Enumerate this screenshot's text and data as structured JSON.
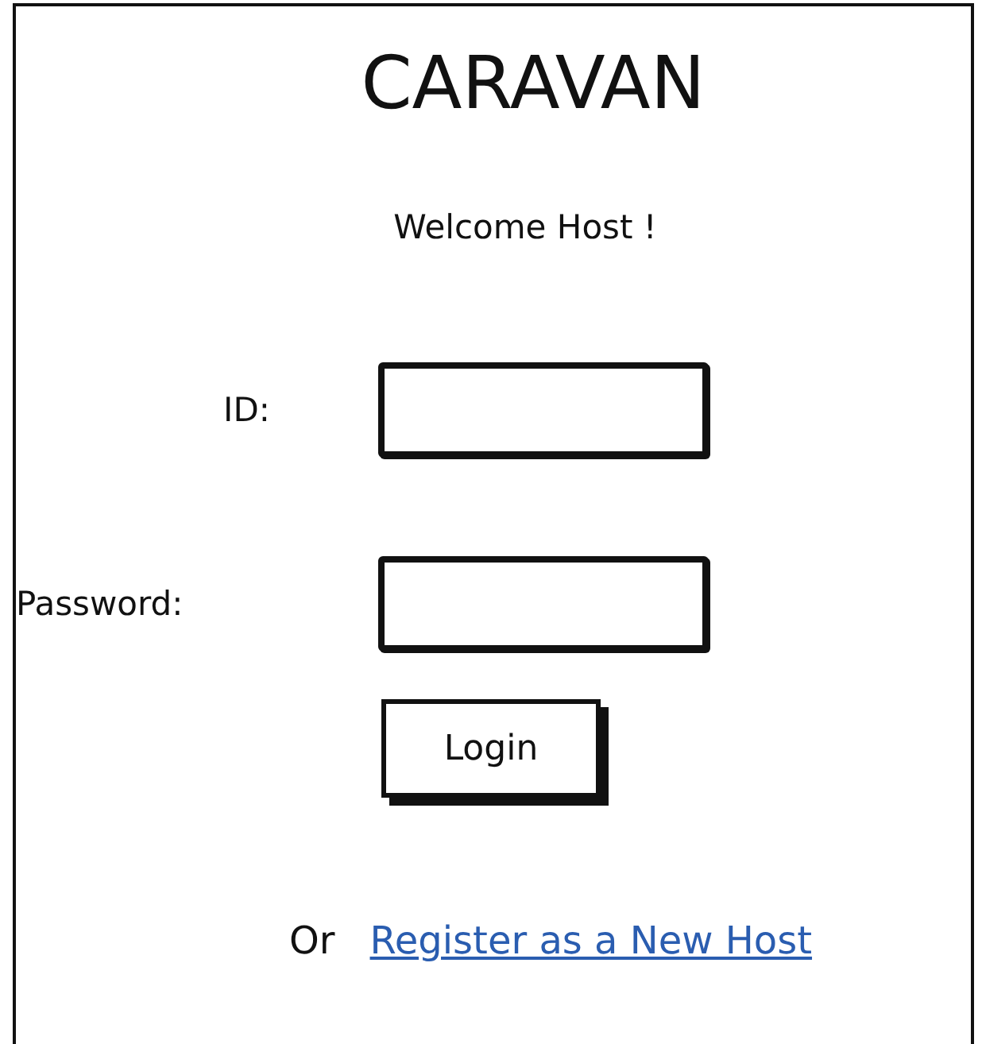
{
  "title": "CARAVAN",
  "welcome": "Welcome Host !",
  "fields": [
    {
      "label": "ID:"
    },
    {
      "label": "Password:"
    }
  ],
  "login_button": "Login",
  "register": {
    "prefix": "Or",
    "link": "Register as a New Host"
  }
}
